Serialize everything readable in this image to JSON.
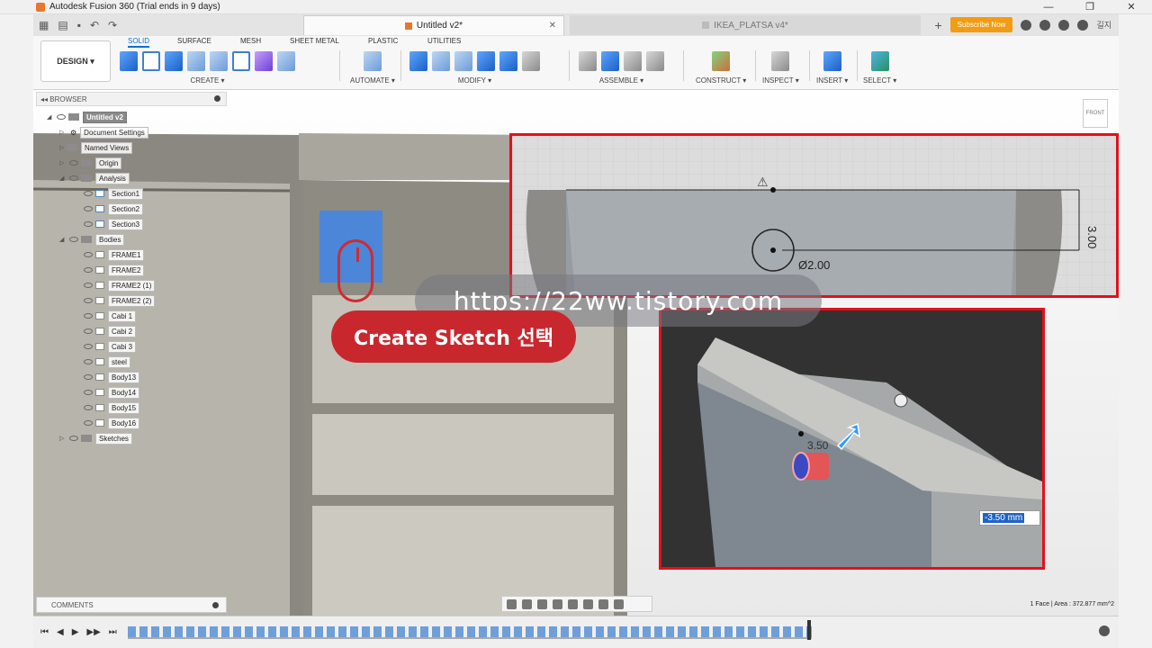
{
  "window": {
    "title": "Autodesk Fusion 360 (Trial ends in 9 days)"
  },
  "tabs": {
    "active": "Untitled v2*",
    "inactive": "IKEA_PLATSA v4*",
    "subscribe": "Subscribe Now",
    "user": "길지"
  },
  "ribbon": {
    "design": "DESIGN ▾",
    "tabs": [
      "SOLID",
      "SURFACE",
      "MESH",
      "SHEET METAL",
      "PLASTIC",
      "UTILITIES"
    ],
    "groups": [
      "CREATE ▾",
      "AUTOMATE ▾",
      "MODIFY ▾",
      "ASSEMBLE ▾",
      "CONSTRUCT ▾",
      "INSPECT ▾",
      "INSERT ▾",
      "SELECT ▾"
    ]
  },
  "browser": {
    "title": "BROWSER",
    "root": "Untitled v2",
    "items": [
      "Document Settings",
      "Named Views",
      "Origin",
      "Analysis",
      "Section1",
      "Section2",
      "Section3",
      "Bodies",
      "FRAME1",
      "FRAME2",
      "FRAME2 (1)",
      "FRAME2 (2)",
      "Cabi 1",
      "Cabi 2",
      "Cabi 3",
      "steel",
      "Body13",
      "Body14",
      "Body15",
      "Body16",
      "Sketches"
    ]
  },
  "comments": {
    "label": "COMMENTS"
  },
  "status": {
    "text": "1 Face | Area : 372.877 mm^2"
  },
  "viewcube": {
    "label": "FRONT"
  },
  "callout1": {
    "dim_vertical": "3.00",
    "dim_diameter": "Ø2.00"
  },
  "callout2": {
    "dim_label": "3.50",
    "input_value": "-3.50 mm"
  },
  "overlay": {
    "watermark": "https://22ww.tistory.com",
    "instruction": "Create Sketch 선택"
  }
}
